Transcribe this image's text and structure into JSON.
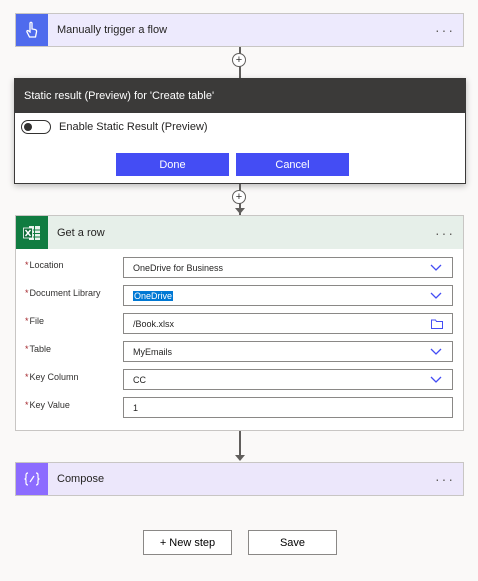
{
  "trigger": {
    "title": "Manually trigger a flow",
    "menu": "···",
    "accent": "#4f6bed"
  },
  "static_result": {
    "heading": "Static result (Preview) for 'Create table'",
    "toggle_label": "Enable Static Result (Preview)",
    "toggle_on": false,
    "done_label": "Done",
    "cancel_label": "Cancel",
    "button_color": "#444df4"
  },
  "get_row": {
    "title": "Get a row",
    "menu": "···",
    "accent": "#107c41",
    "header_bg": "#e6efe9",
    "fields": [
      {
        "label": "Location",
        "value": "OneDrive for Business",
        "control": "dropdown"
      },
      {
        "label": "Document Library",
        "value": "OneDrive",
        "control": "dropdown"
      },
      {
        "label": "File",
        "value": "/Book.xlsx",
        "control": "file-picker"
      },
      {
        "label": "Table",
        "value": "MyEmails",
        "control": "dropdown"
      },
      {
        "label": "Key Column",
        "value": "CC",
        "control": "dropdown"
      },
      {
        "label": "Key Value",
        "value": "1",
        "control": "text"
      }
    ]
  },
  "compose": {
    "title": "Compose",
    "menu": "···",
    "accent": "#8c6cff",
    "header_bg": "#ece7fb"
  },
  "footer": {
    "new_step_label": "+ New step",
    "save_label": "Save"
  },
  "icons": {
    "trigger": "hand-tap-icon",
    "get_row": "excel-icon",
    "compose": "compose-braces-icon",
    "plus_glyph": "+"
  }
}
